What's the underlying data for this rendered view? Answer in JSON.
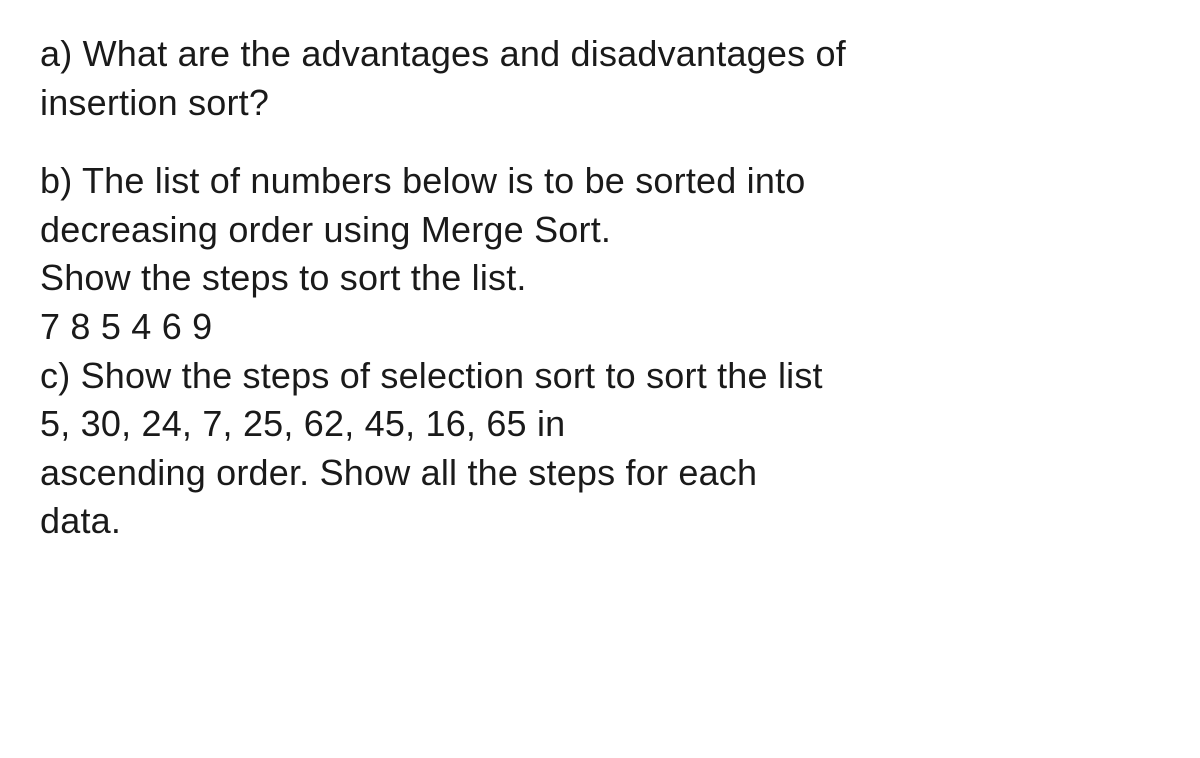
{
  "questions": {
    "a": {
      "line1": "a) What are the advantages and disadvantages of",
      "line2": "insertion sort?"
    },
    "b": {
      "line1": "b) The list of numbers below is to be sorted into",
      "line2": "decreasing order using Merge Sort.",
      "line3": "Show the steps to sort the list.",
      "line4": "7 8 5 4 6 9"
    },
    "c": {
      "line1": "c) Show the steps of selection sort to sort the list",
      "line2": "5, 30, 24, 7, 25, 62, 45, 16, 65 in",
      "line3": "ascending order. Show all the steps for each",
      "line4": "data."
    }
  }
}
